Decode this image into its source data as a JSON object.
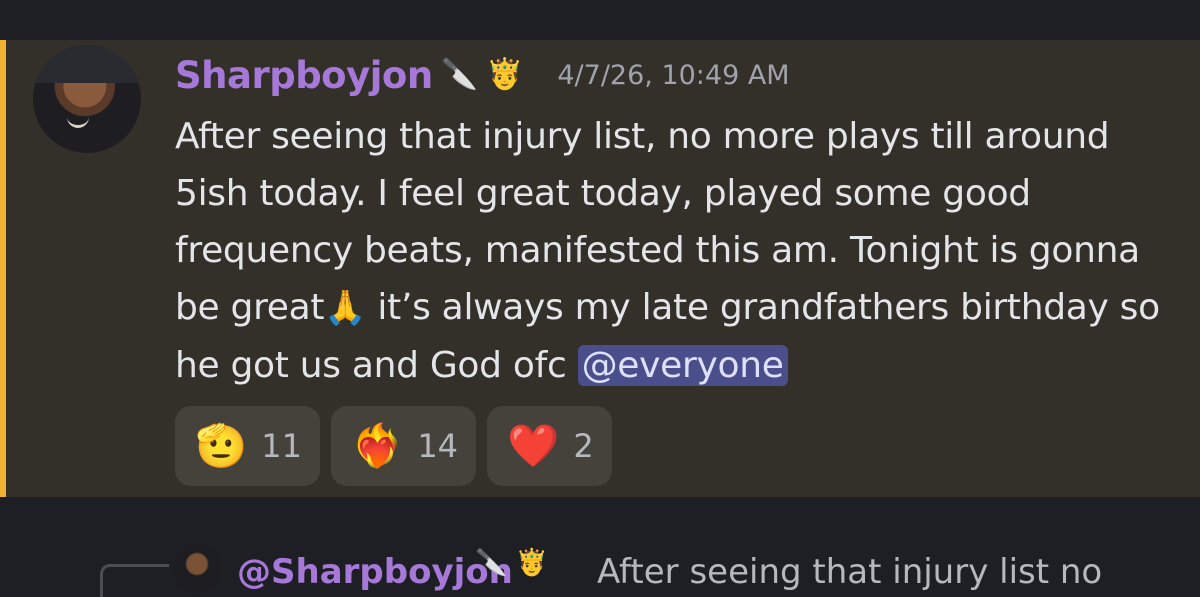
{
  "message": {
    "username": "Sharpboyjon",
    "badges": [
      "🔪",
      "🤴"
    ],
    "timestamp": "4/7/26, 10:49 AM",
    "text_part1": "After seeing that injury list, no more plays till around 5ish today. I feel great today, played some good frequency beats, manifested this am. Tonight is gonna be great",
    "text_emoji": "🙏",
    "text_part2": " it’s always my late grandfathers birthday so he got us and God ofc ",
    "mention": "@everyone",
    "reactions": [
      {
        "emoji": "🫡",
        "count": "11",
        "icon": "saluting-face-icon"
      },
      {
        "emoji": "❤️‍🔥",
        "count": "14",
        "icon": "heart-on-fire-icon"
      },
      {
        "emoji": "❤️",
        "count": "2",
        "icon": "red-heart-icon"
      }
    ]
  },
  "reply_preview": {
    "username": "@Sharpboyjon",
    "badges": "🔪 🤴",
    "text": "After seeing that injury list no"
  },
  "colors": {
    "accent_mention_bar": "#f0b232",
    "username": "#a679d8",
    "mention_bg": "#4a4f8c"
  }
}
